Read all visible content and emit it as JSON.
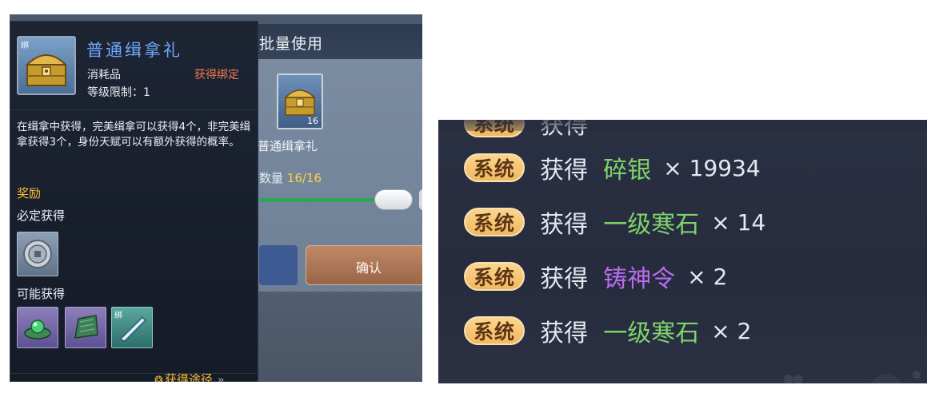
{
  "batch": {
    "title": "批量使用",
    "item_name": "普通缉拿礼",
    "item_count": "16",
    "qty_label": "数量",
    "qty_value": "16/16",
    "confirm_label": "确认"
  },
  "tooltip": {
    "bind_tag": "绑",
    "name": "普通缉拿礼",
    "type": "消耗品",
    "bind_status": "获得绑定",
    "level": "等级限制：1",
    "description": "在缉拿中获得，完美缉拿可以获得4个，非完美缉拿获得3个，身份天赋可以有额外获得的概率。",
    "reward_title": "奖励",
    "sure_title": "必定获得",
    "possible_title": "可能获得",
    "possible_bind_tag": "绑",
    "source_label": "获得途径",
    "source_arrow": "»",
    "icons": {
      "item": "treasure-chest-icon",
      "sure": [
        "silver-coin-icon"
      ],
      "possible": [
        "jade-gem-icon",
        "jade-stone-icon",
        "blade-shard-icon"
      ]
    }
  },
  "chat": [
    {
      "badge": "系统",
      "verb": "获得",
      "item": "碎银",
      "qty": "× 19934",
      "color": "#7ed36a"
    },
    {
      "badge": "系统",
      "verb": "获得",
      "item": "一级寒石",
      "qty": "× 14",
      "color": "#7ed36a"
    },
    {
      "badge": "系统",
      "verb": "获得",
      "item": "铸神令",
      "qty": "× 2",
      "color": "#bb6cf2"
    },
    {
      "badge": "系统",
      "verb": "获得",
      "item": "一级寒石",
      "qty": "× 2",
      "color": "#7ed36a"
    }
  ]
}
